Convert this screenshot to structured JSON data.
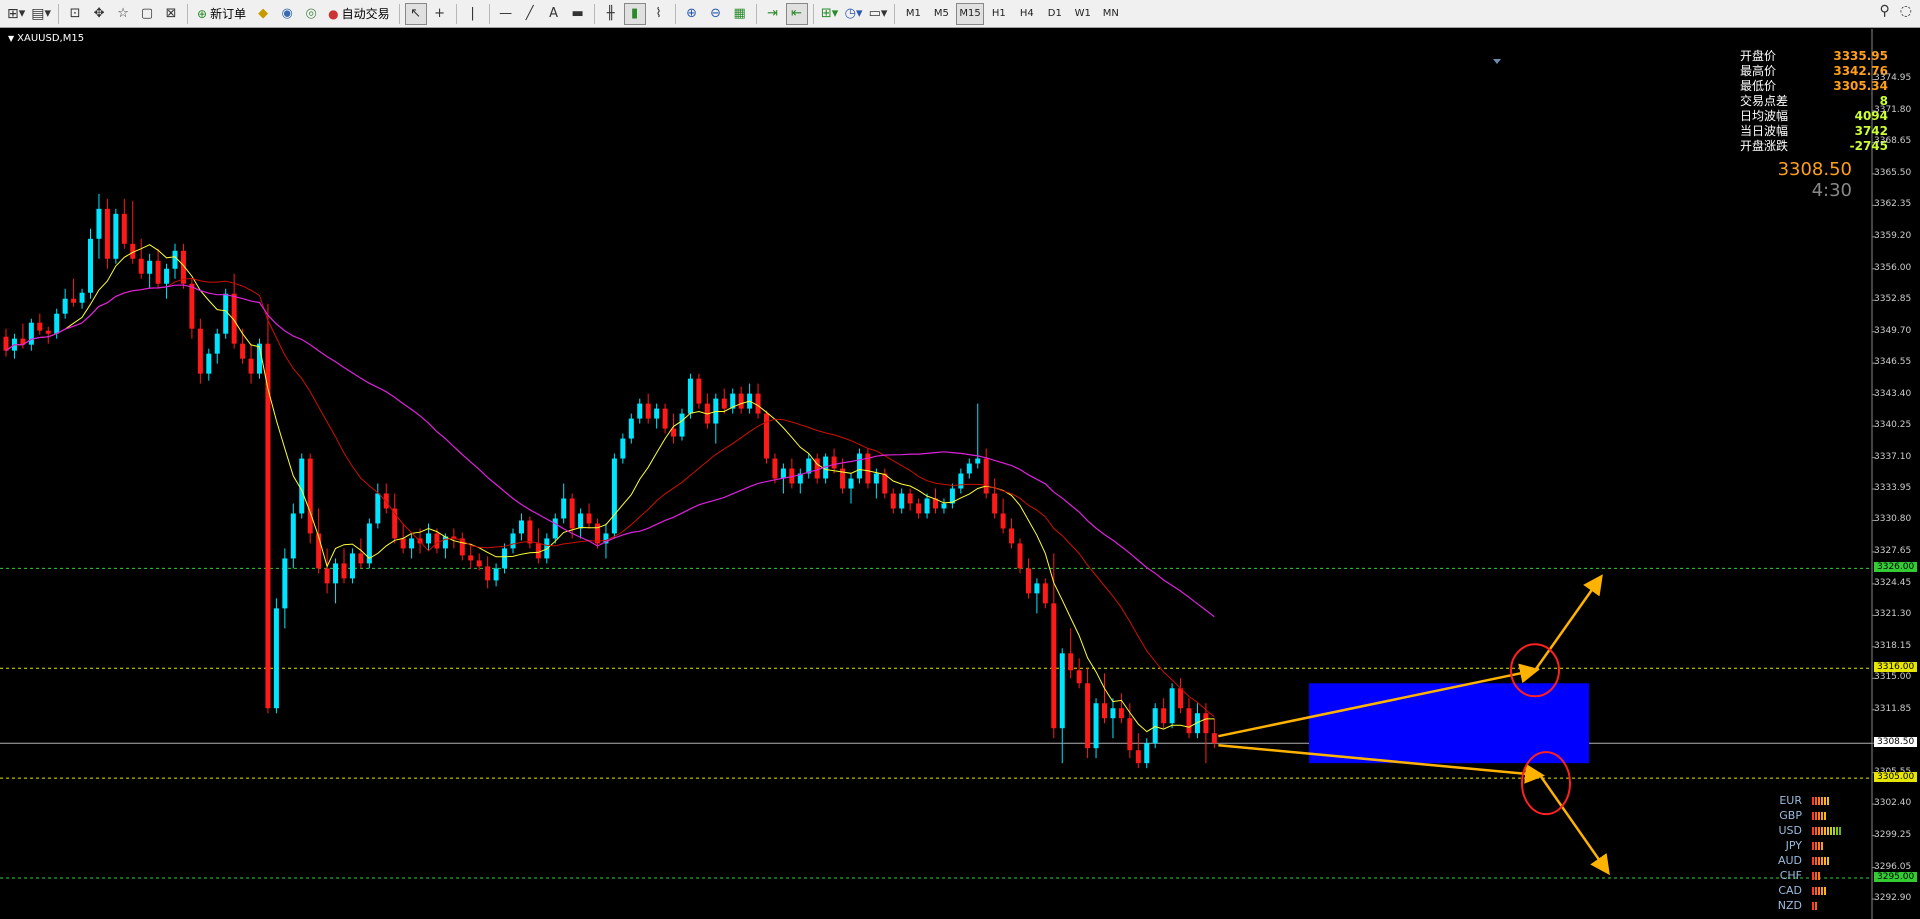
{
  "toolbar": {
    "new_order_label": "新订单",
    "auto_trade_label": "自动交易",
    "timeframes": [
      "M1",
      "M5",
      "M15",
      "H1",
      "H4",
      "D1",
      "W1",
      "MN"
    ],
    "active_timeframe": "M15"
  },
  "chart": {
    "symbol_label": "XAUUSD,M15",
    "last_price": "3308.50",
    "countdown": "4:30"
  },
  "stats": [
    {
      "label": "开盘价",
      "value": "3335.95",
      "color": "#ff9f1a"
    },
    {
      "label": "最高价",
      "value": "3342.76",
      "color": "#ff9f1a"
    },
    {
      "label": "最低价",
      "value": "3305.34",
      "color": "#ff9f1a"
    },
    {
      "label": "交易点差",
      "value": "8",
      "color": "#ccff33"
    },
    {
      "label": "日均波幅",
      "value": "4094",
      "color": "#ccff33"
    },
    {
      "label": "当日波幅",
      "value": "3742",
      "color": "#ccff33"
    },
    {
      "label": "开盘涨跌",
      "value": "-2745",
      "color": "#ccff33"
    }
  ],
  "price_axis": [
    "3374.95",
    "3371.80",
    "3368.65",
    "3365.50",
    "3362.35",
    "3359.20",
    "3356.00",
    "3352.85",
    "3349.70",
    "3346.55",
    "3343.40",
    "3340.25",
    "3337.10",
    "3333.95",
    "3330.80",
    "3327.65",
    "3324.45",
    "3321.30",
    "3318.15",
    "3315.00",
    "3311.85",
    "3308.50",
    "3305.55",
    "3302.40",
    "3299.25",
    "3296.05",
    "3292.90"
  ],
  "horizontal_lines": [
    {
      "price": "3326.00",
      "color": "#33cc33"
    },
    {
      "price": "3316.00",
      "color": "#e6e600"
    },
    {
      "price": "3305.00",
      "color": "#e6e600"
    },
    {
      "price": "3295.00",
      "color": "#33cc33"
    }
  ],
  "current_price_tag": "3308.50",
  "currency_strength": [
    {
      "code": "EUR",
      "level": 6
    },
    {
      "code": "GBP",
      "level": 5
    },
    {
      "code": "USD",
      "level": 10
    },
    {
      "code": "JPY",
      "level": 4
    },
    {
      "code": "AUD",
      "level": 6
    },
    {
      "code": "CHF",
      "level": 3
    },
    {
      "code": "CAD",
      "level": 5
    },
    {
      "code": "NZD",
      "level": 2
    }
  ],
  "colors": {
    "bull": "#00e5ff",
    "bear": "#ff1a1a",
    "ma_fast": "#ffff33",
    "ma_mid": "#cc1100",
    "ma_slow": "#dd22dd",
    "range_box": "#0000ff",
    "arrow": "#ffb300",
    "circle": "#ff2020"
  },
  "candles": [
    [
      3349.2,
      3350.0,
      3347.2,
      3347.8
    ],
    [
      3347.8,
      3349.5,
      3347.0,
      3349.0
    ],
    [
      3349.0,
      3350.5,
      3348.0,
      3348.4
    ],
    [
      3348.4,
      3351.0,
      3347.8,
      3350.6
    ],
    [
      3350.6,
      3351.5,
      3349.4,
      3349.8
    ],
    [
      3349.8,
      3350.2,
      3348.5,
      3349.5
    ],
    [
      3349.5,
      3352.0,
      3349.0,
      3351.5
    ],
    [
      3351.5,
      3354.0,
      3351.0,
      3353.0
    ],
    [
      3353.0,
      3355.0,
      3352.2,
      3352.6
    ],
    [
      3352.6,
      3354.0,
      3352.0,
      3353.6
    ],
    [
      3353.6,
      3360.0,
      3353.0,
      3359.0
    ],
    [
      3359.0,
      3363.5,
      3357.0,
      3362.0
    ],
    [
      3362.0,
      3363.0,
      3356.0,
      3357.0
    ],
    [
      3357.0,
      3362.0,
      3356.5,
      3361.5
    ],
    [
      3361.5,
      3363.0,
      3358.0,
      3358.5
    ],
    [
      3358.5,
      3362.8,
      3356.5,
      3357.0
    ],
    [
      3357.0,
      3359.0,
      3355.0,
      3355.5
    ],
    [
      3355.5,
      3357.5,
      3354.0,
      3356.8
    ],
    [
      3356.8,
      3358.0,
      3354.0,
      3354.5
    ],
    [
      3354.5,
      3356.5,
      3353.0,
      3356.0
    ],
    [
      3356.0,
      3358.5,
      3355.0,
      3357.8
    ],
    [
      3357.8,
      3358.5,
      3354.0,
      3354.5
    ],
    [
      3354.5,
      3355.0,
      3349.0,
      3350.0
    ],
    [
      3350.0,
      3351.0,
      3344.5,
      3345.5
    ],
    [
      3345.5,
      3348.0,
      3344.8,
      3347.5
    ],
    [
      3347.5,
      3350.0,
      3346.5,
      3349.5
    ],
    [
      3349.5,
      3354.0,
      3349.0,
      3353.5
    ],
    [
      3353.5,
      3355.5,
      3348.0,
      3348.5
    ],
    [
      3348.5,
      3350.0,
      3346.5,
      3347.0
    ],
    [
      3347.0,
      3348.5,
      3344.5,
      3345.5
    ],
    [
      3345.5,
      3349.0,
      3345.0,
      3348.5
    ],
    [
      3348.5,
      3352.5,
      3311.5,
      3312.0
    ],
    [
      3312.0,
      3323.0,
      3311.5,
      3322.0
    ],
    [
      3322.0,
      3328.0,
      3320.0,
      3327.0
    ],
    [
      3327.0,
      3332.5,
      3326.0,
      3331.5
    ],
    [
      3331.5,
      3337.5,
      3331.0,
      3337.0
    ],
    [
      3337.0,
      3337.5,
      3328.5,
      3329.5
    ],
    [
      3329.5,
      3332.0,
      3325.5,
      3326.0
    ],
    [
      3326.0,
      3328.0,
      3323.5,
      3324.5
    ],
    [
      3324.5,
      3327.0,
      3322.5,
      3326.5
    ],
    [
      3326.5,
      3328.0,
      3324.5,
      3325.0
    ],
    [
      3325.0,
      3328.0,
      3324.5,
      3327.5
    ],
    [
      3327.5,
      3329.0,
      3326.0,
      3326.5
    ],
    [
      3326.5,
      3331.0,
      3326.0,
      3330.5
    ],
    [
      3330.5,
      3334.5,
      3330.0,
      3333.5
    ],
    [
      3333.5,
      3334.5,
      3331.5,
      3332.0
    ],
    [
      3332.0,
      3333.5,
      3328.5,
      3329.0
    ],
    [
      3329.0,
      3330.5,
      3327.5,
      3328.0
    ],
    [
      3328.0,
      3329.5,
      3327.0,
      3329.0
    ],
    [
      3329.0,
      3330.0,
      3327.5,
      3328.5
    ],
    [
      3328.5,
      3330.5,
      3327.8,
      3329.5
    ],
    [
      3329.5,
      3330.0,
      3327.5,
      3328.0
    ],
    [
      3328.0,
      3329.5,
      3327.0,
      3329.2
    ],
    [
      3329.2,
      3330.0,
      3328.0,
      3329.0
    ],
    [
      3329.0,
      3329.6,
      3326.8,
      3327.3
    ],
    [
      3327.3,
      3328.5,
      3326.0,
      3326.8
    ],
    [
      3326.8,
      3327.5,
      3325.8,
      3326.2
    ],
    [
      3326.2,
      3327.2,
      3324.0,
      3324.8
    ],
    [
      3324.8,
      3326.5,
      3324.2,
      3326.0
    ],
    [
      3326.0,
      3328.5,
      3325.5,
      3328.0
    ],
    [
      3328.0,
      3330.0,
      3327.5,
      3329.5
    ],
    [
      3329.5,
      3331.5,
      3328.8,
      3330.8
    ],
    [
      3330.8,
      3331.2,
      3328.0,
      3328.5
    ],
    [
      3328.5,
      3330.0,
      3326.5,
      3327.0
    ],
    [
      3327.0,
      3329.5,
      3326.5,
      3329.0
    ],
    [
      3329.0,
      3331.5,
      3328.5,
      3331.0
    ],
    [
      3331.0,
      3334.5,
      3330.5,
      3333.0
    ],
    [
      3333.0,
      3333.5,
      3329.0,
      3330.0
    ],
    [
      3330.0,
      3332.0,
      3329.0,
      3331.5
    ],
    [
      3331.5,
      3332.5,
      3330.0,
      3330.5
    ],
    [
      3330.5,
      3331.0,
      3328.0,
      3328.5
    ],
    [
      3328.5,
      3330.5,
      3327.0,
      3329.5
    ],
    [
      3329.5,
      3337.5,
      3329.0,
      3337.0
    ],
    [
      3337.0,
      3339.5,
      3336.5,
      3339.0
    ],
    [
      3339.0,
      3341.5,
      3338.5,
      3341.0
    ],
    [
      3341.0,
      3343.0,
      3340.5,
      3342.5
    ],
    [
      3342.5,
      3343.5,
      3340.5,
      3341.0
    ],
    [
      3341.0,
      3342.5,
      3340.0,
      3342.0
    ],
    [
      3342.0,
      3342.5,
      3339.5,
      3340.0
    ],
    [
      3340.0,
      3341.5,
      3338.5,
      3339.2
    ],
    [
      3339.2,
      3342.0,
      3338.8,
      3341.5
    ],
    [
      3341.5,
      3345.5,
      3341.0,
      3345.0
    ],
    [
      3345.0,
      3345.5,
      3342.0,
      3342.5
    ],
    [
      3342.5,
      3343.5,
      3340.0,
      3340.5
    ],
    [
      3340.5,
      3343.5,
      3338.5,
      3343.0
    ],
    [
      3343.0,
      3344.0,
      3341.5,
      3342.0
    ],
    [
      3342.0,
      3344.0,
      3341.5,
      3343.5
    ],
    [
      3343.5,
      3344.2,
      3341.5,
      3342.0
    ],
    [
      3342.0,
      3344.5,
      3341.5,
      3343.5
    ],
    [
      3343.5,
      3344.5,
      3341.0,
      3341.5
    ],
    [
      3341.5,
      3341.8,
      3336.5,
      3337.0
    ],
    [
      3337.0,
      3337.5,
      3334.5,
      3335.0
    ],
    [
      3335.0,
      3336.5,
      3333.5,
      3336.0
    ],
    [
      3336.0,
      3337.0,
      3334.0,
      3334.5
    ],
    [
      3334.5,
      3336.0,
      3333.5,
      3335.5
    ],
    [
      3335.5,
      3337.5,
      3335.0,
      3337.0
    ],
    [
      3337.0,
      3337.5,
      3334.5,
      3335.0
    ],
    [
      3335.0,
      3337.5,
      3334.5,
      3337.2
    ],
    [
      3337.2,
      3338.0,
      3335.5,
      3336.0
    ],
    [
      3336.0,
      3337.0,
      3333.5,
      3334.0
    ],
    [
      3334.0,
      3335.5,
      3332.5,
      3335.0
    ],
    [
      3335.0,
      3338.0,
      3334.5,
      3337.5
    ],
    [
      3337.5,
      3338.0,
      3334.0,
      3334.5
    ],
    [
      3334.5,
      3336.0,
      3333.0,
      3335.5
    ],
    [
      3335.5,
      3336.0,
      3333.0,
      3333.5
    ],
    [
      3333.5,
      3334.0,
      3331.5,
      3332.0
    ],
    [
      3332.0,
      3334.0,
      3331.5,
      3333.5
    ],
    [
      3333.5,
      3334.0,
      3331.8,
      3332.5
    ],
    [
      3332.5,
      3333.0,
      3331.0,
      3331.5
    ],
    [
      3331.5,
      3333.5,
      3331.0,
      3333.0
    ],
    [
      3333.0,
      3334.0,
      3331.5,
      3332.0
    ],
    [
      3332.0,
      3333.0,
      3331.5,
      3332.5
    ],
    [
      3332.5,
      3334.5,
      3332.0,
      3334.0
    ],
    [
      3334.0,
      3336.0,
      3333.5,
      3335.5
    ],
    [
      3335.5,
      3337.0,
      3335.0,
      3336.5
    ],
    [
      3336.5,
      3342.5,
      3336.0,
      3337.0
    ],
    [
      3337.0,
      3338.0,
      3333.0,
      3333.5
    ],
    [
      3333.5,
      3335.0,
      3331.0,
      3331.5
    ],
    [
      3331.5,
      3333.0,
      3329.5,
      3330.0
    ],
    [
      3330.0,
      3331.0,
      3328.0,
      3328.5
    ],
    [
      3328.5,
      3329.0,
      3325.5,
      3326.0
    ],
    [
      3326.0,
      3327.0,
      3323.0,
      3323.5
    ],
    [
      3323.5,
      3325.0,
      3321.5,
      3324.5
    ],
    [
      3324.5,
      3325.0,
      3322.0,
      3322.5
    ],
    [
      3322.5,
      3327.5,
      3309.0,
      3310.0
    ],
    [
      3310.0,
      3318.0,
      3306.5,
      3317.5
    ],
    [
      3317.5,
      3320.0,
      3315.0,
      3315.8
    ],
    [
      3315.8,
      3317.0,
      3314.0,
      3314.5
    ],
    [
      3314.5,
      3316.0,
      3307.0,
      3308.0
    ],
    [
      3308.0,
      3313.0,
      3307.0,
      3312.5
    ],
    [
      3312.5,
      3315.5,
      3310.5,
      3311.0
    ],
    [
      3311.0,
      3313.0,
      3309.0,
      3312.0
    ],
    [
      3312.0,
      3313.5,
      3310.5,
      3311.0
    ],
    [
      3311.0,
      3312.5,
      3307.0,
      3307.8
    ],
    [
      3307.8,
      3309.5,
      3306.0,
      3306.5
    ],
    [
      3306.5,
      3309.0,
      3306.0,
      3308.5
    ],
    [
      3308.5,
      3312.5,
      3308.0,
      3312.0
    ],
    [
      3312.0,
      3313.0,
      3310.0,
      3310.5
    ],
    [
      3310.5,
      3314.5,
      3310.0,
      3314.0
    ],
    [
      3314.0,
      3315.0,
      3311.5,
      3312.0
    ],
    [
      3312.0,
      3313.0,
      3309.0,
      3309.5
    ],
    [
      3309.5,
      3312.5,
      3309.0,
      3311.5
    ],
    [
      3311.5,
      3312.5,
      3306.5,
      3309.5
    ],
    [
      3309.5,
      3311.0,
      3308.0,
      3308.5
    ]
  ]
}
